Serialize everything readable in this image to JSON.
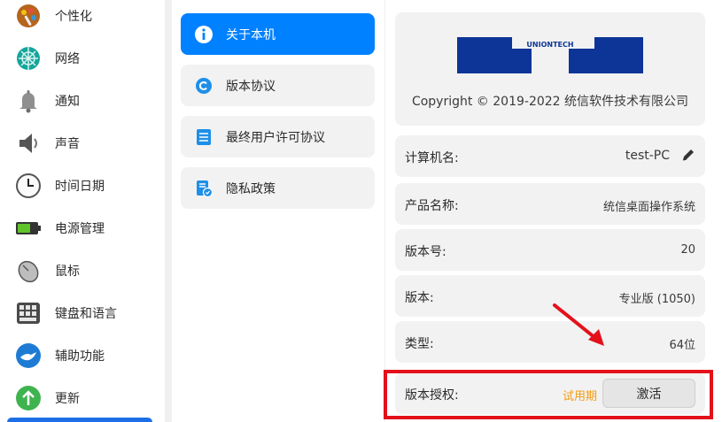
{
  "sidebar": {
    "items": [
      {
        "label": "个性化",
        "icon": "palette-icon"
      },
      {
        "label": "网络",
        "icon": "network-globe-icon"
      },
      {
        "label": "通知",
        "icon": "bell-icon"
      },
      {
        "label": "声音",
        "icon": "speaker-icon"
      },
      {
        "label": "时间日期",
        "icon": "clock-icon"
      },
      {
        "label": "电源管理",
        "icon": "battery-icon"
      },
      {
        "label": "鼠标",
        "icon": "mouse-icon"
      },
      {
        "label": "键盘和语言",
        "icon": "keyboard-icon"
      },
      {
        "label": "辅助功能",
        "icon": "accessibility-hand-icon"
      },
      {
        "label": "更新",
        "icon": "update-arrow-icon"
      }
    ]
  },
  "about_menu": {
    "items": [
      {
        "label": "关于本机",
        "icon": "info-icon",
        "active": true
      },
      {
        "label": "版本协议",
        "icon": "copyright-icon",
        "active": false
      },
      {
        "label": "最终用户许可协议",
        "icon": "document-icon",
        "active": false
      },
      {
        "label": "隐私政策",
        "icon": "privacy-policy-icon",
        "active": false
      }
    ]
  },
  "details": {
    "logo_text": "UNIONTECH",
    "copyright": "Copyright © 2019-2022 统信软件技术有限公司",
    "computer_name_label": "计算机名:",
    "computer_name_value": "test-PC",
    "product_name_label": "产品名称:",
    "product_name_value": "统信桌面操作系统",
    "version_number_label": "版本号:",
    "version_number_value": "20",
    "edition_label": "版本:",
    "edition_value": "专业版 (1050)",
    "type_label": "类型:",
    "type_value": "64位",
    "license_label": "版本授权:",
    "license_status": "试用期",
    "activate_label": "激活"
  },
  "colors": {
    "accent": "#0081ff",
    "trial": "#f39c12",
    "highlight": "#e3111a",
    "logo_blue": "#0d3597"
  }
}
